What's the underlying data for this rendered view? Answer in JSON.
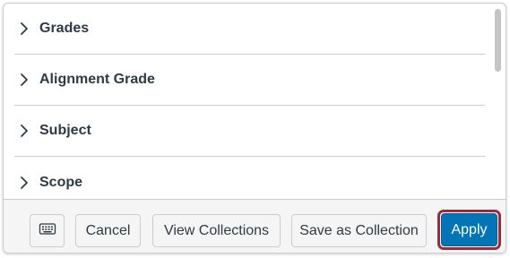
{
  "filters": [
    {
      "label": "Grades",
      "icon": "chevron-right-icon"
    },
    {
      "label": "Alignment Grade",
      "icon": "chevron-right-icon"
    },
    {
      "label": "Subject",
      "icon": "chevron-right-icon"
    },
    {
      "label": "Scope",
      "icon": "chevron-right-icon"
    }
  ],
  "footer": {
    "keyboard_icon": "keyboard-icon",
    "cancel_label": "Cancel",
    "view_collections_label": "View Collections",
    "save_collection_label": "Save as Collection",
    "apply_label": "Apply"
  },
  "colors": {
    "primary": "#0374b5",
    "highlight": "#9b2d3a",
    "text": "#2d3b45",
    "border": "#c7cdd1"
  }
}
